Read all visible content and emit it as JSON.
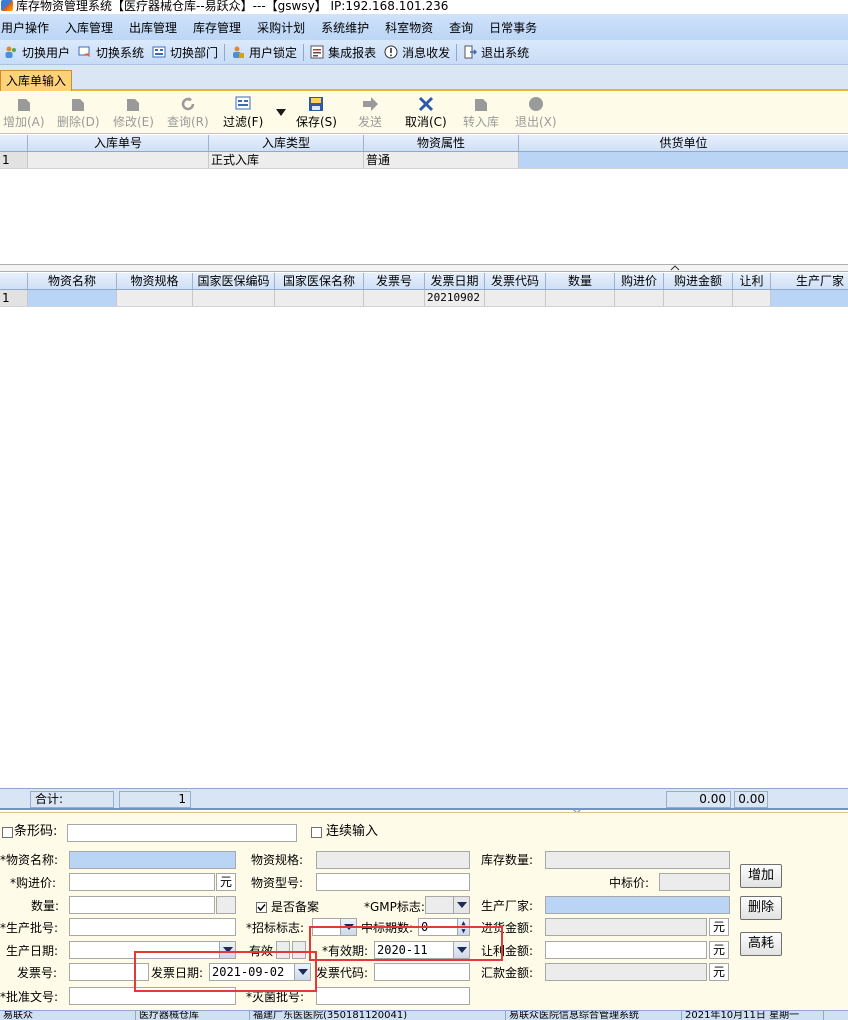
{
  "window": {
    "title": "库存物资管理系统【医疗器械仓库--易跃众】---【gswsy】 IP:192.168.101.236"
  },
  "menu": [
    "用户操作",
    "入库管理",
    "出库管理",
    "库存管理",
    "采购计划",
    "系统维护",
    "科室物资",
    "查询",
    "日常事务"
  ],
  "toolbar": [
    {
      "label": "切换用户",
      "icon": "users-icon"
    },
    {
      "label": "切换系统",
      "icon": "switch-system-icon"
    },
    {
      "label": "切换部门",
      "icon": "department-icon"
    },
    {
      "label": "用户锁定",
      "icon": "lock-user-icon"
    },
    {
      "label": "集成报表",
      "icon": "report-icon"
    },
    {
      "label": "消息收发",
      "icon": "message-icon"
    },
    {
      "label": "退出系统",
      "icon": "exit-icon"
    }
  ],
  "tab": {
    "label": "入库单输入"
  },
  "actions": {
    "add": "增加(A)",
    "delete": "删除(D)",
    "modify": "修改(E)",
    "query": "查询(R)",
    "filter": "过滤(F)",
    "save": "保存(S)",
    "send": "发送",
    "cancel": "取消(C)",
    "transfer": "转入库",
    "exit": "退出(X)"
  },
  "grid1": {
    "headers": [
      "入库单号",
      "入库类型",
      "物资属性",
      "供货单位"
    ],
    "rows": [
      {
        "num": "1",
        "cells": [
          "",
          "正式入库",
          "普通",
          ""
        ]
      }
    ]
  },
  "grid2": {
    "headers": [
      "物资名称",
      "物资规格",
      "国家医保编码",
      "国家医保名称",
      "发票号",
      "发票日期",
      "发票代码",
      "数量",
      "购进价",
      "购进金额",
      "让利",
      "生产厂家"
    ],
    "rows": [
      {
        "num": "1",
        "cells": [
          "",
          "",
          "",
          "",
          "",
          "20210902",
          "",
          "",
          "",
          "",
          "",
          ""
        ]
      }
    ]
  },
  "totals": {
    "label": "合计:",
    "count": "1",
    "amount1": "0.00",
    "amount2": "0.00"
  },
  "form": {
    "barcode_label": "条形码:",
    "continuous_label": "连续输入",
    "name_label": "*物资名称:",
    "spec_label": "物资规格:",
    "stock_qty_label": "库存数量:",
    "price_label": "*购进价:",
    "unit_yuan": "元",
    "model_label": "物资型号:",
    "bid_price_label": "中标价:",
    "qty_label": "数量:",
    "filed_label": "是否备案",
    "gmp_label": "*GMP标志:",
    "maker_label": "生产厂家:",
    "batch_label": "*生产批号:",
    "bid_flag_label": "*招标标志:",
    "bid_count_label": "中标期数:",
    "bid_count_value": "0",
    "purchase_amount_label": "进货金额:",
    "prod_date_label": "生产日期:",
    "valid_label": "有效",
    "expiry_label": "*有效期:",
    "expiry_value": "2020-11",
    "discount_amount_label": "让利金额:",
    "invoice_no_label": "发票号:",
    "invoice_date_label": "发票日期:",
    "invoice_date_value": "2021-09-02",
    "invoice_code_label": "发票代码:",
    "remit_amount_label": "汇款金额:",
    "approval_label": "*批准文号:",
    "sterile_label": "*灭菌批号:",
    "btn_add": "增加",
    "btn_delete": "删除",
    "btn_high": "高耗"
  },
  "status": [
    "易联众",
    "医疗器械仓库",
    "福建广东医医院(350181120041)",
    "易联众医院信息综合管理系统",
    "2021年10月11日 星期一"
  ]
}
